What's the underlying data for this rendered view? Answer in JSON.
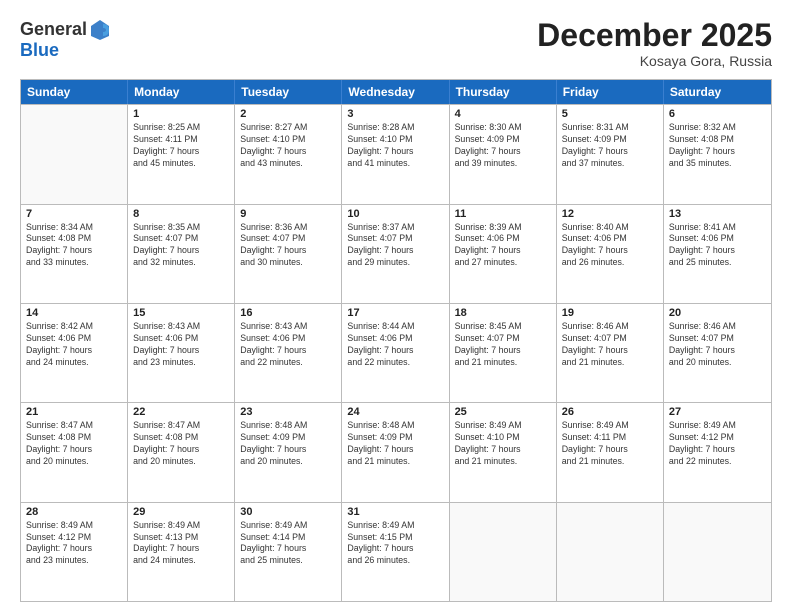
{
  "header": {
    "logo_general": "General",
    "logo_blue": "Blue",
    "month_title": "December 2025",
    "location": "Kosaya Gora, Russia"
  },
  "days_of_week": [
    "Sunday",
    "Monday",
    "Tuesday",
    "Wednesday",
    "Thursday",
    "Friday",
    "Saturday"
  ],
  "weeks": [
    [
      {
        "day": "",
        "info": ""
      },
      {
        "day": "1",
        "info": "Sunrise: 8:25 AM\nSunset: 4:11 PM\nDaylight: 7 hours\nand 45 minutes."
      },
      {
        "day": "2",
        "info": "Sunrise: 8:27 AM\nSunset: 4:10 PM\nDaylight: 7 hours\nand 43 minutes."
      },
      {
        "day": "3",
        "info": "Sunrise: 8:28 AM\nSunset: 4:10 PM\nDaylight: 7 hours\nand 41 minutes."
      },
      {
        "day": "4",
        "info": "Sunrise: 8:30 AM\nSunset: 4:09 PM\nDaylight: 7 hours\nand 39 minutes."
      },
      {
        "day": "5",
        "info": "Sunrise: 8:31 AM\nSunset: 4:09 PM\nDaylight: 7 hours\nand 37 minutes."
      },
      {
        "day": "6",
        "info": "Sunrise: 8:32 AM\nSunset: 4:08 PM\nDaylight: 7 hours\nand 35 minutes."
      }
    ],
    [
      {
        "day": "7",
        "info": "Sunrise: 8:34 AM\nSunset: 4:08 PM\nDaylight: 7 hours\nand 33 minutes."
      },
      {
        "day": "8",
        "info": "Sunrise: 8:35 AM\nSunset: 4:07 PM\nDaylight: 7 hours\nand 32 minutes."
      },
      {
        "day": "9",
        "info": "Sunrise: 8:36 AM\nSunset: 4:07 PM\nDaylight: 7 hours\nand 30 minutes."
      },
      {
        "day": "10",
        "info": "Sunrise: 8:37 AM\nSunset: 4:07 PM\nDaylight: 7 hours\nand 29 minutes."
      },
      {
        "day": "11",
        "info": "Sunrise: 8:39 AM\nSunset: 4:06 PM\nDaylight: 7 hours\nand 27 minutes."
      },
      {
        "day": "12",
        "info": "Sunrise: 8:40 AM\nSunset: 4:06 PM\nDaylight: 7 hours\nand 26 minutes."
      },
      {
        "day": "13",
        "info": "Sunrise: 8:41 AM\nSunset: 4:06 PM\nDaylight: 7 hours\nand 25 minutes."
      }
    ],
    [
      {
        "day": "14",
        "info": "Sunrise: 8:42 AM\nSunset: 4:06 PM\nDaylight: 7 hours\nand 24 minutes."
      },
      {
        "day": "15",
        "info": "Sunrise: 8:43 AM\nSunset: 4:06 PM\nDaylight: 7 hours\nand 23 minutes."
      },
      {
        "day": "16",
        "info": "Sunrise: 8:43 AM\nSunset: 4:06 PM\nDaylight: 7 hours\nand 22 minutes."
      },
      {
        "day": "17",
        "info": "Sunrise: 8:44 AM\nSunset: 4:06 PM\nDaylight: 7 hours\nand 22 minutes."
      },
      {
        "day": "18",
        "info": "Sunrise: 8:45 AM\nSunset: 4:07 PM\nDaylight: 7 hours\nand 21 minutes."
      },
      {
        "day": "19",
        "info": "Sunrise: 8:46 AM\nSunset: 4:07 PM\nDaylight: 7 hours\nand 21 minutes."
      },
      {
        "day": "20",
        "info": "Sunrise: 8:46 AM\nSunset: 4:07 PM\nDaylight: 7 hours\nand 20 minutes."
      }
    ],
    [
      {
        "day": "21",
        "info": "Sunrise: 8:47 AM\nSunset: 4:08 PM\nDaylight: 7 hours\nand 20 minutes."
      },
      {
        "day": "22",
        "info": "Sunrise: 8:47 AM\nSunset: 4:08 PM\nDaylight: 7 hours\nand 20 minutes."
      },
      {
        "day": "23",
        "info": "Sunrise: 8:48 AM\nSunset: 4:09 PM\nDaylight: 7 hours\nand 20 minutes."
      },
      {
        "day": "24",
        "info": "Sunrise: 8:48 AM\nSunset: 4:09 PM\nDaylight: 7 hours\nand 21 minutes."
      },
      {
        "day": "25",
        "info": "Sunrise: 8:49 AM\nSunset: 4:10 PM\nDaylight: 7 hours\nand 21 minutes."
      },
      {
        "day": "26",
        "info": "Sunrise: 8:49 AM\nSunset: 4:11 PM\nDaylight: 7 hours\nand 21 minutes."
      },
      {
        "day": "27",
        "info": "Sunrise: 8:49 AM\nSunset: 4:12 PM\nDaylight: 7 hours\nand 22 minutes."
      }
    ],
    [
      {
        "day": "28",
        "info": "Sunrise: 8:49 AM\nSunset: 4:12 PM\nDaylight: 7 hours\nand 23 minutes."
      },
      {
        "day": "29",
        "info": "Sunrise: 8:49 AM\nSunset: 4:13 PM\nDaylight: 7 hours\nand 24 minutes."
      },
      {
        "day": "30",
        "info": "Sunrise: 8:49 AM\nSunset: 4:14 PM\nDaylight: 7 hours\nand 25 minutes."
      },
      {
        "day": "31",
        "info": "Sunrise: 8:49 AM\nSunset: 4:15 PM\nDaylight: 7 hours\nand 26 minutes."
      },
      {
        "day": "",
        "info": ""
      },
      {
        "day": "",
        "info": ""
      },
      {
        "day": "",
        "info": ""
      }
    ]
  ]
}
